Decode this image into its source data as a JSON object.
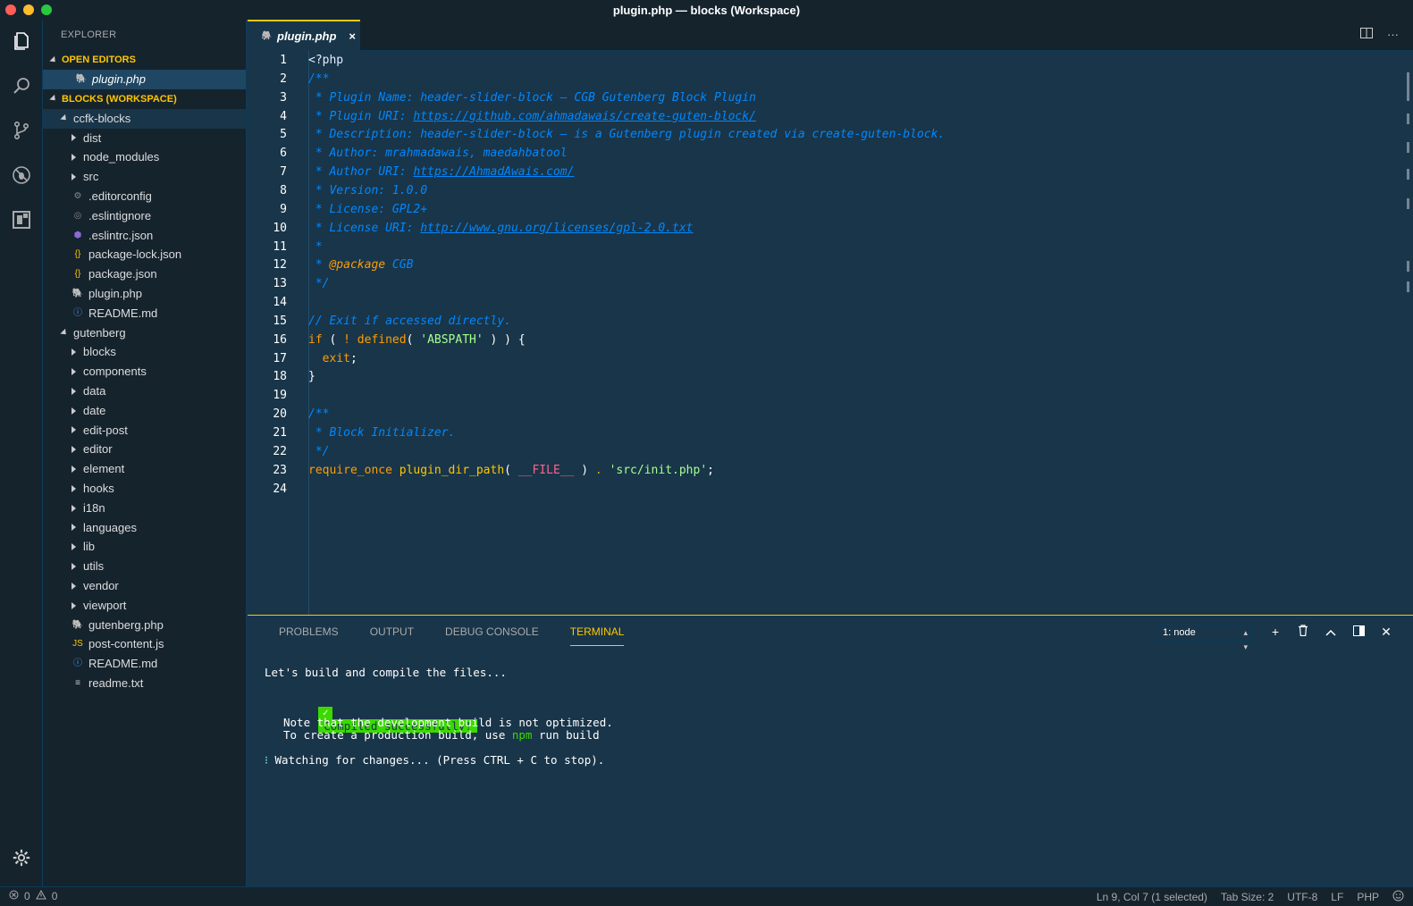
{
  "window": {
    "title": "plugin.php — blocks (Workspace)"
  },
  "sidebar": {
    "title": "EXPLORER",
    "open_editors_label": "OPEN EDITORS",
    "open_editors": [
      {
        "name": "plugin.php",
        "icon": "php-elephant-icon"
      }
    ],
    "workspace_label": "BLOCKS (WORKSPACE)",
    "folders": [
      {
        "name": "ccfk-blocks",
        "children": [
          {
            "name": "dist",
            "type": "folder"
          },
          {
            "name": "node_modules",
            "type": "folder"
          },
          {
            "name": "src",
            "type": "folder"
          },
          {
            "name": ".editorconfig",
            "type": "file",
            "icon": "gear-icon"
          },
          {
            "name": ".eslintignore",
            "type": "file",
            "icon": "circle-icon"
          },
          {
            "name": ".eslintrc.json",
            "type": "file",
            "icon": "eslint-icon"
          },
          {
            "name": "package-lock.json",
            "type": "file",
            "icon": "json-braces-icon"
          },
          {
            "name": "package.json",
            "type": "file",
            "icon": "json-braces-icon"
          },
          {
            "name": "plugin.php",
            "type": "file",
            "icon": "php-elephant-icon"
          },
          {
            "name": "README.md",
            "type": "file",
            "icon": "info-icon"
          }
        ]
      },
      {
        "name": "gutenberg",
        "children": [
          {
            "name": "blocks",
            "type": "folder"
          },
          {
            "name": "components",
            "type": "folder"
          },
          {
            "name": "data",
            "type": "folder"
          },
          {
            "name": "date",
            "type": "folder"
          },
          {
            "name": "edit-post",
            "type": "folder"
          },
          {
            "name": "editor",
            "type": "folder"
          },
          {
            "name": "element",
            "type": "folder"
          },
          {
            "name": "hooks",
            "type": "folder"
          },
          {
            "name": "i18n",
            "type": "folder"
          },
          {
            "name": "languages",
            "type": "folder"
          },
          {
            "name": "lib",
            "type": "folder"
          },
          {
            "name": "utils",
            "type": "folder"
          },
          {
            "name": "vendor",
            "type": "folder"
          },
          {
            "name": "viewport",
            "type": "folder"
          },
          {
            "name": "gutenberg.php",
            "type": "file",
            "icon": "php-elephant-icon"
          },
          {
            "name": "post-content.js",
            "type": "file",
            "icon": "js-icon"
          },
          {
            "name": "README.md",
            "type": "file",
            "icon": "info-icon"
          },
          {
            "name": "readme.txt",
            "type": "file",
            "icon": "lines-icon"
          }
        ]
      }
    ]
  },
  "editor": {
    "tab": {
      "label": "plugin.php",
      "close": "×"
    },
    "lines": [
      [
        [
          "c-php",
          "<?php"
        ]
      ],
      [
        [
          "c-com",
          "/**"
        ]
      ],
      [
        [
          "c-com",
          " * Plugin Name: header-slider-block — CGB Gutenberg Block Plugin"
        ]
      ],
      [
        [
          "c-com",
          " * Plugin URI: "
        ],
        [
          "c-link",
          "https://github.com/ahmadawais/create-guten-block/"
        ]
      ],
      [
        [
          "c-com",
          " * Description: header-slider-block — is a Gutenberg plugin created via create-guten-block."
        ]
      ],
      [
        [
          "c-com",
          " * Author: mrahmadawais, maedahbatool"
        ]
      ],
      [
        [
          "c-com",
          " * Author URI: "
        ],
        [
          "c-link",
          "https://AhmadAwais.com/"
        ]
      ],
      [
        [
          "c-com",
          " * Version: 1.0.0"
        ]
      ],
      [
        [
          "c-com",
          " * License: GPL2+"
        ]
      ],
      [
        [
          "c-com",
          " * License URI: "
        ],
        [
          "c-link",
          "http://www.gnu.org/licenses/gpl-2.0.txt"
        ]
      ],
      [
        [
          "c-com",
          " *"
        ]
      ],
      [
        [
          "c-com",
          " * "
        ],
        [
          "c-tag",
          "@package"
        ],
        [
          "c-com",
          " CGB"
        ]
      ],
      [
        [
          "c-com",
          " */"
        ]
      ],
      [],
      [
        [
          "c-com",
          "// Exit if accessed directly."
        ]
      ],
      [
        [
          "c-kw",
          "if"
        ],
        [
          "c-plain",
          " ( "
        ],
        [
          "c-op",
          "!"
        ],
        [
          "c-plain",
          " "
        ],
        [
          "c-kw",
          "defined"
        ],
        [
          "c-plain",
          "( "
        ],
        [
          "c-str",
          "'ABSPATH'"
        ],
        [
          "c-plain",
          " ) ) {"
        ]
      ],
      [
        [
          "c-plain",
          "  "
        ],
        [
          "c-kw",
          "exit"
        ],
        [
          "c-plain",
          ";"
        ]
      ],
      [
        [
          "c-plain",
          "}"
        ]
      ],
      [],
      [
        [
          "c-com",
          "/**"
        ]
      ],
      [
        [
          "c-com",
          " * Block Initializer."
        ]
      ],
      [
        [
          "c-com",
          " */"
        ]
      ],
      [
        [
          "c-kw",
          "require_once"
        ],
        [
          "c-plain",
          " "
        ],
        [
          "c-fn",
          "plugin_dir_path"
        ],
        [
          "c-plain",
          "( "
        ],
        [
          "c-const",
          "__FILE__"
        ],
        [
          "c-plain",
          " ) "
        ],
        [
          "c-op",
          "."
        ],
        [
          "c-plain",
          " "
        ],
        [
          "c-str",
          "'src/init.php'"
        ],
        [
          "c-plain",
          ";"
        ]
      ],
      []
    ],
    "line_numbers": [
      "1",
      "2",
      "3",
      "4",
      "5",
      "6",
      "7",
      "8",
      "9",
      "10",
      "11",
      "12",
      "13",
      "14",
      "15",
      "16",
      "17",
      "18",
      "19",
      "20",
      "21",
      "22",
      "23",
      "24"
    ]
  },
  "panel": {
    "tabs": [
      "PROBLEMS",
      "OUTPUT",
      "DEBUG CONSOLE",
      "TERMINAL"
    ],
    "active_tab": "TERMINAL",
    "terminal_select": "1: node",
    "terminal": {
      "line1": "Let's build and compile the files...",
      "check": "✓",
      "success": "Compiled successfully!",
      "note1": "Note that the development build is not optimized.",
      "note2_prefix": "To create a production build, use ",
      "note2_npm": "npm",
      "note2_suffix": " run build",
      "watching_marker": "⁝",
      "watching": " Watching for changes... (Press CTRL + C to stop)."
    }
  },
  "statusbar": {
    "errors": "0",
    "warnings": "0",
    "position": "Ln 9, Col 7 (1 selected)",
    "tab_size": "Tab Size: 2",
    "encoding": "UTF-8",
    "eol": "LF",
    "language": "PHP"
  },
  "colors": {
    "accent": "#ffc600",
    "background": "#193549",
    "sidebar": "#15232d"
  }
}
